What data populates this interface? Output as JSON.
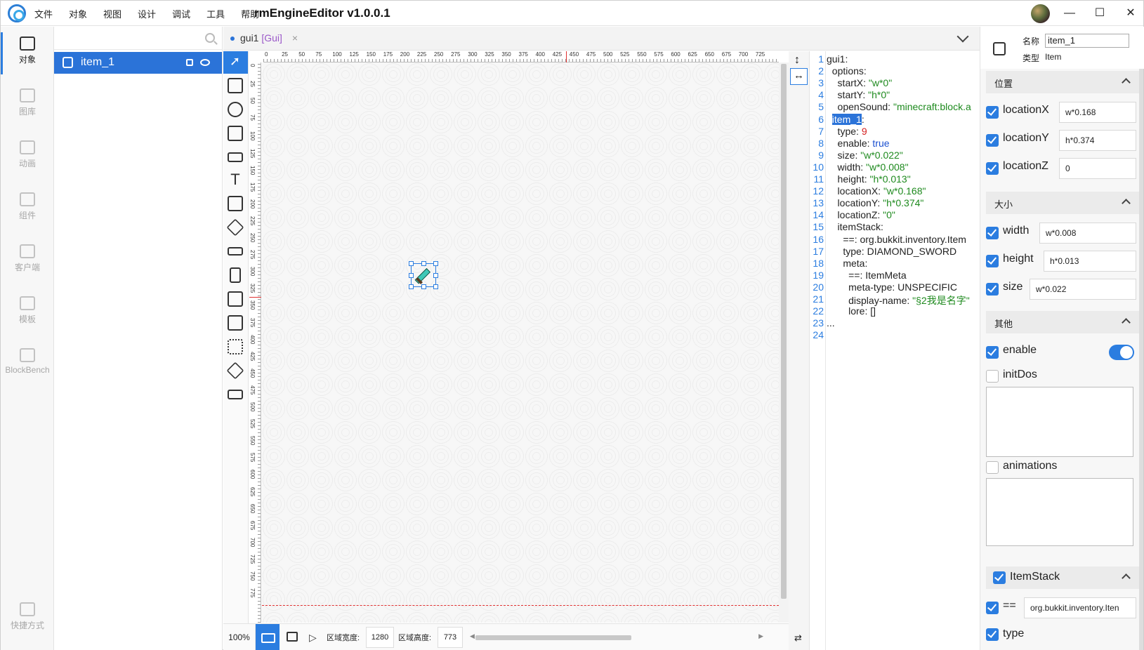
{
  "titlebar": {
    "menu": [
      "文件",
      "对象",
      "视图",
      "设计",
      "调试",
      "工具",
      "帮助"
    ],
    "title": "rmEngineEditor v1.0.0.1",
    "min": "—",
    "max": "☐",
    "close": "✕"
  },
  "leftnav": {
    "items": [
      {
        "label": "对象",
        "icon": "layers-icon"
      },
      {
        "label": "图库",
        "icon": "image-icon"
      },
      {
        "label": "动画",
        "icon": "video-icon"
      },
      {
        "label": "组件",
        "icon": "puzzle-icon"
      },
      {
        "label": "客户端",
        "icon": "creeper-icon"
      },
      {
        "label": "模板",
        "icon": "template-icon"
      },
      {
        "label": "BlockBench",
        "icon": "blockbench-icon"
      }
    ],
    "shortcut": "快捷方式"
  },
  "objects": {
    "search_placeholder": "",
    "items": [
      {
        "name": "item_1"
      }
    ]
  },
  "tabs": [
    {
      "name": "gui1",
      "type": "[Gui]",
      "close": "×"
    }
  ],
  "ruler": {
    "x_ticks": [
      "0",
      "25",
      "50",
      "75",
      "100",
      "125",
      "150",
      "175",
      "200",
      "225",
      "250",
      "275",
      "300",
      "325",
      "350",
      "375",
      "400",
      "425",
      "450",
      "475",
      "500",
      "525",
      "550",
      "575",
      "600",
      "625",
      "650",
      "675",
      "700",
      "725"
    ],
    "y_ticks": [
      "0",
      "25",
      "50",
      "75",
      "100",
      "125",
      "150",
      "175",
      "200",
      "225",
      "250",
      "275",
      "300",
      "325",
      "350",
      "375",
      "400",
      "425",
      "450",
      "475",
      "500",
      "525",
      "550",
      "575",
      "600",
      "625",
      "650",
      "675",
      "700",
      "725",
      "750",
      "775"
    ]
  },
  "status": {
    "zoom": "100%",
    "width_label": "区域宽度:",
    "width_value": "1280",
    "height_label": "区域高度:",
    "height_value": "773"
  },
  "code": {
    "line_numbers": [
      "1",
      "2",
      "3",
      "4",
      "5",
      "6",
      "7",
      "8",
      "9",
      "10",
      "11",
      "12",
      "13",
      "14",
      "15",
      "16",
      "17",
      "18",
      "19",
      "20",
      "21",
      "22",
      "23",
      "24"
    ],
    "lines": [
      [
        {
          "t": "gui1:",
          "c": ""
        }
      ],
      [
        {
          "t": "  options:",
          "c": ""
        }
      ],
      [
        {
          "t": "    startX: ",
          "c": ""
        },
        {
          "t": "\"w*0\"",
          "c": "str"
        }
      ],
      [
        {
          "t": "    startY: ",
          "c": ""
        },
        {
          "t": "\"h*0\"",
          "c": "str"
        }
      ],
      [
        {
          "t": "    openSound: ",
          "c": ""
        },
        {
          "t": "\"minecraft:block.a",
          "c": "str"
        }
      ],
      [
        {
          "t": "  ",
          "c": ""
        },
        {
          "t": "item_1",
          "c": "hl"
        },
        {
          "t": ":",
          "c": ""
        }
      ],
      [
        {
          "t": "    type: ",
          "c": ""
        },
        {
          "t": "9",
          "c": "num"
        }
      ],
      [
        {
          "t": "    enable: ",
          "c": ""
        },
        {
          "t": "true",
          "c": "kw"
        }
      ],
      [
        {
          "t": "    size: ",
          "c": ""
        },
        {
          "t": "\"w*0.022\"",
          "c": "str"
        }
      ],
      [
        {
          "t": "    width: ",
          "c": ""
        },
        {
          "t": "\"w*0.008\"",
          "c": "str"
        }
      ],
      [
        {
          "t": "    height: ",
          "c": ""
        },
        {
          "t": "\"h*0.013\"",
          "c": "str"
        }
      ],
      [
        {
          "t": "    locationX: ",
          "c": ""
        },
        {
          "t": "\"w*0.168\"",
          "c": "str"
        }
      ],
      [
        {
          "t": "    locationY: ",
          "c": ""
        },
        {
          "t": "\"h*0.374\"",
          "c": "str"
        }
      ],
      [
        {
          "t": "    locationZ: ",
          "c": ""
        },
        {
          "t": "\"0\"",
          "c": "str"
        }
      ],
      [
        {
          "t": "    itemStack:",
          "c": ""
        }
      ],
      [
        {
          "t": "      ==: org.bukkit.inventory.Item",
          "c": ""
        }
      ],
      [
        {
          "t": "      type: DIAMOND_SWORD",
          "c": ""
        }
      ],
      [
        {
          "t": "      meta:",
          "c": ""
        }
      ],
      [
        {
          "t": "        ==: ItemMeta",
          "c": ""
        }
      ],
      [
        {
          "t": "        meta-type: UNSPECIFIC",
          "c": ""
        }
      ],
      [
        {
          "t": "        display-name: ",
          "c": ""
        },
        {
          "t": "\"§2我是名字\"",
          "c": "str"
        }
      ],
      [
        {
          "t": "        lore: []",
          "c": ""
        }
      ],
      [
        {
          "t": "...",
          "c": ""
        }
      ],
      [
        {
          "t": "",
          "c": ""
        }
      ]
    ]
  },
  "properties": {
    "name_label": "名称",
    "name_value": "item_1",
    "type_label": "类型",
    "type_value": "Item",
    "sections": {
      "position": "位置",
      "size": "大小",
      "other": "其他",
      "itemstack": "ItemStack"
    },
    "fields": {
      "locationX": {
        "label": "locationX",
        "value": "w*0.168",
        "checked": true
      },
      "locationY": {
        "label": "locationY",
        "value": "h*0.374",
        "checked": true
      },
      "locationZ": {
        "label": "locationZ",
        "value": "0",
        "checked": true
      },
      "width": {
        "label": "width",
        "value": "w*0.008",
        "checked": true
      },
      "height": {
        "label": "height",
        "value": "h*0.013",
        "checked": true
      },
      "size": {
        "label": "size",
        "value": "w*0.022",
        "checked": true
      },
      "enable": {
        "label": "enable",
        "checked": true,
        "toggle": true
      },
      "initDos": {
        "label": "initDos",
        "checked": false
      },
      "animations": {
        "label": "animations",
        "checked": false
      },
      "eqeq": {
        "label": "==",
        "value": "org.bukkit.inventory.Iten",
        "checked": true
      },
      "type": {
        "label": "type",
        "checked": true
      }
    }
  },
  "colors": {
    "accent": "#2b7de0",
    "string": "#1e8a1e",
    "number": "#d42020",
    "keyword": "#1a4fd0",
    "ruler_marker": "#e03030"
  }
}
